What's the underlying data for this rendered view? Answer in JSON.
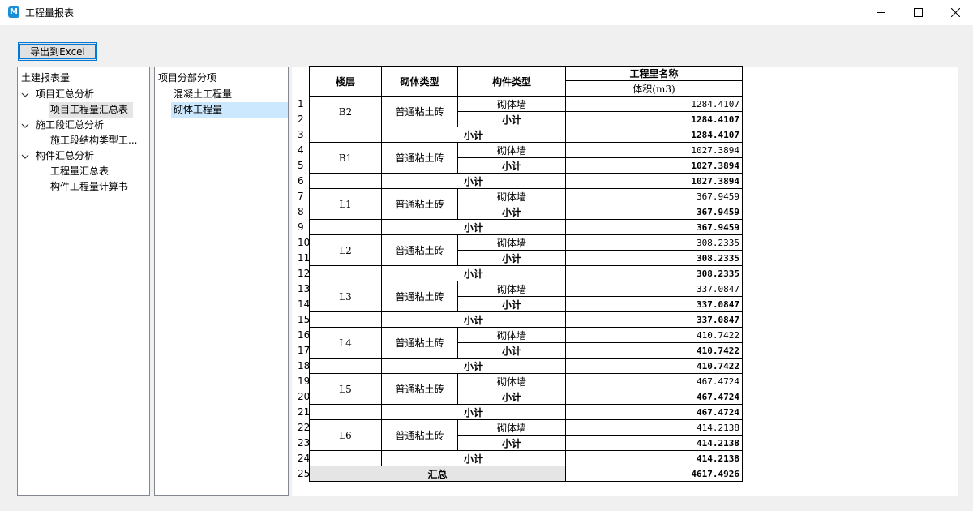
{
  "window": {
    "title": "工程量报表",
    "icon": "M"
  },
  "toolbar": {
    "export_label": "导出到Excel"
  },
  "left_tree": {
    "header": "土建报表量",
    "items": [
      {
        "label": "项目汇总分析",
        "level": 1,
        "expanded": true,
        "selected": false
      },
      {
        "label": "项目工程量汇总表",
        "level": 2,
        "selected": true
      },
      {
        "label": "施工段汇总分析",
        "level": 1,
        "expanded": true,
        "selected": false
      },
      {
        "label": "施工段结构类型工...",
        "level": 2,
        "selected": false
      },
      {
        "label": "构件汇总分析",
        "level": 1,
        "expanded": true,
        "selected": false
      },
      {
        "label": "工程量汇总表",
        "level": 2,
        "selected": false
      },
      {
        "label": "构件工程量计算书",
        "level": 2,
        "selected": false
      }
    ]
  },
  "mid_list": {
    "header": "项目分部分项",
    "items": [
      {
        "label": "混凝土工程量",
        "selected": false
      },
      {
        "label": "砌体工程量",
        "selected": true
      }
    ]
  },
  "table": {
    "headers": {
      "floor": "楼层",
      "masonry_type": "砌体类型",
      "component_type": "构件类型",
      "quantity_name": "工程里名称",
      "volume": "体积(m3)"
    },
    "masonry_label": "普通粘土砖",
    "component_label": "砌体墙",
    "subtotal_label": "小计",
    "total_label": "汇总",
    "groups": [
      {
        "floor": "B2",
        "value": "1284.4107"
      },
      {
        "floor": "B1",
        "value": "1027.3894"
      },
      {
        "floor": "L1",
        "value": "367.9459"
      },
      {
        "floor": "L2",
        "value": "308.2335"
      },
      {
        "floor": "L3",
        "value": "337.0847"
      },
      {
        "floor": "L4",
        "value": "410.7422"
      },
      {
        "floor": "L5",
        "value": "467.4724"
      },
      {
        "floor": "L6",
        "value": "414.2138"
      }
    ],
    "total_value": "4617.4926",
    "row_numbers": [
      "1",
      "2",
      "3",
      "4",
      "5",
      "6",
      "7",
      "8",
      "9",
      "10",
      "11",
      "12",
      "13",
      "14",
      "15",
      "16",
      "17",
      "18",
      "19",
      "20",
      "21",
      "22",
      "23",
      "24",
      "25"
    ]
  }
}
